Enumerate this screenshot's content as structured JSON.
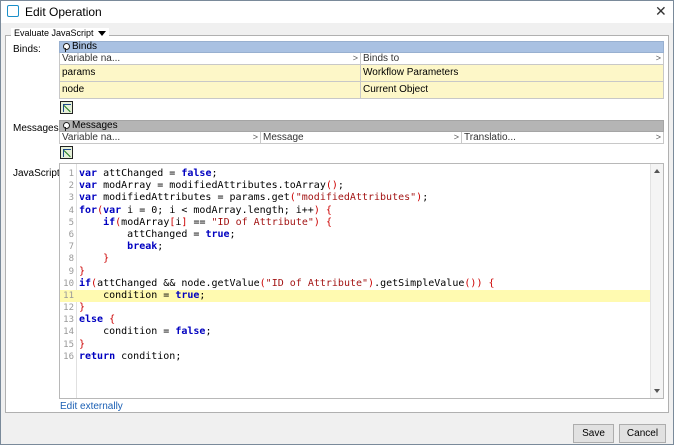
{
  "window": {
    "title": "Edit Operation",
    "close_glyph": "✕"
  },
  "group": {
    "label": "Evaluate JavaScript"
  },
  "labels": {
    "binds": "Binds:",
    "messages": "Messages:",
    "javascript": "JavaScript:"
  },
  "binds": {
    "header": "Binds",
    "columns": [
      "Variable na...",
      "Binds to"
    ],
    "rows": [
      [
        "params",
        "Workflow Parameters"
      ],
      [
        "node",
        "Current Object"
      ]
    ]
  },
  "messages": {
    "header": "Messages",
    "columns": [
      "Variable na...",
      "Message",
      "Translatio..."
    ]
  },
  "code": {
    "lines": [
      "var attChanged = false;",
      "var modArray = modifiedAttributes.toArray();",
      "var modifiedAttributes = params.get(\"modifiedAttributes\");",
      "for(var i = 0; i < modArray.length; i++) {",
      "    if(modArray[i] == \"ID of Attribute\") {",
      "        attChanged = true;",
      "        break;",
      "    }",
      "}",
      "if(attChanged && node.getValue(\"ID of Attribute\").getSimpleValue()) {",
      "    condition = true;",
      "}",
      "else {",
      "    condition = false;",
      "}",
      "return condition;"
    ],
    "highlighted_line": 11
  },
  "edit_externally": "Edit externally",
  "buttons": {
    "save": "Save",
    "cancel": "Cancel"
  }
}
